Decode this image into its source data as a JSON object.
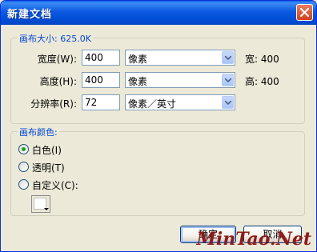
{
  "window": {
    "title": "新建文档"
  },
  "canvas_size": {
    "group_title": "画布大小: 625.0K",
    "width_label": "宽度(W):",
    "width_value": "400",
    "width_unit": "像素",
    "width_info": "宽: 400",
    "height_label": "高度(H):",
    "height_value": "400",
    "height_unit": "像素",
    "height_info": "高: 400",
    "resolution_label": "分辨率(R):",
    "resolution_value": "72",
    "resolution_unit": "像素／英寸"
  },
  "canvas_color": {
    "group_title": "画布颜色:",
    "options": [
      {
        "label": "白色(I)",
        "selected": true
      },
      {
        "label": "透明(T)",
        "selected": false
      },
      {
        "label": "自定义(C):",
        "selected": false
      }
    ],
    "custom_color": "#ffffff"
  },
  "buttons": {
    "ok": "确定",
    "cancel": "取消"
  },
  "watermark": "MinTao.Net",
  "colors": {
    "title_bar": "#0a5fe6",
    "group_title": "#0046d5",
    "radio_dot": "#21a121",
    "close_button": "#d0431c"
  },
  "icons": {
    "close": "close-icon",
    "dropdown": "chevron-down-icon",
    "color_picker": "color-swatch-icon"
  }
}
